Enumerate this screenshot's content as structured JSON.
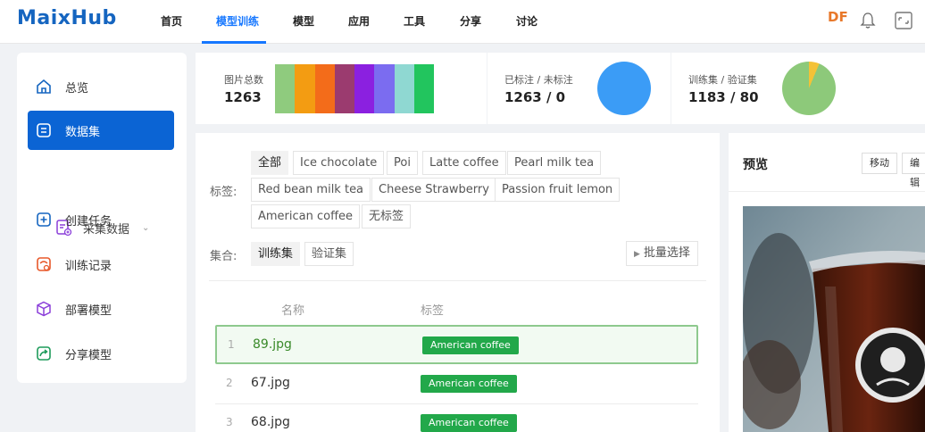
{
  "nav": {
    "logo": "MaixHub",
    "items": [
      "首页",
      "模型训练",
      "模型",
      "应用",
      "工具",
      "分享",
      "讨论"
    ],
    "avatar": "DF"
  },
  "sidebar": {
    "items": [
      "总览",
      "数据集",
      "采集数据",
      "创建任务",
      "训练记录",
      "部署模型",
      "分享模型"
    ]
  },
  "stats": {
    "total_label": "图片总数",
    "total_value": "1263",
    "labeled_label": "已标注 / 未标注",
    "labeled_value": "1263 / 0",
    "split_label": "训练集 / 验证集",
    "split_value": "1183 / 80",
    "split_fraction": 0.063,
    "bar_colors": [
      "#8fcb7e",
      "#f39c12",
      "#f36c1a",
      "#9b3b6f",
      "#8b20e0",
      "#7b6cf0",
      "#8fd8d2",
      "#22c55e"
    ],
    "pie_colors": {
      "labeled": "#3b9cf6",
      "train": "#8dc97a",
      "val": "#f4c237"
    }
  },
  "filters": {
    "tag_label": "标签:",
    "tags": [
      "全部",
      "Ice chocolate",
      "Poi",
      "Latte coffee",
      "Pearl milk tea",
      "Red bean milk tea",
      "Cheese Strawberry",
      "Passion fruit lemon",
      "American coffee",
      "无标签"
    ],
    "set_label": "集合:",
    "sets": [
      "训练集",
      "验证集"
    ],
    "batch_button": "批量选择"
  },
  "table": {
    "columns": [
      "名称",
      "标签"
    ],
    "rows": [
      {
        "num": "1",
        "name": "89.jpg",
        "tag": "American coffee"
      },
      {
        "num": "2",
        "name": "67.jpg",
        "tag": "American coffee"
      },
      {
        "num": "3",
        "name": "68.jpg",
        "tag": "American coffee"
      }
    ]
  },
  "preview": {
    "title": "预览",
    "move_button": "移动",
    "edit_button": "编辑"
  }
}
